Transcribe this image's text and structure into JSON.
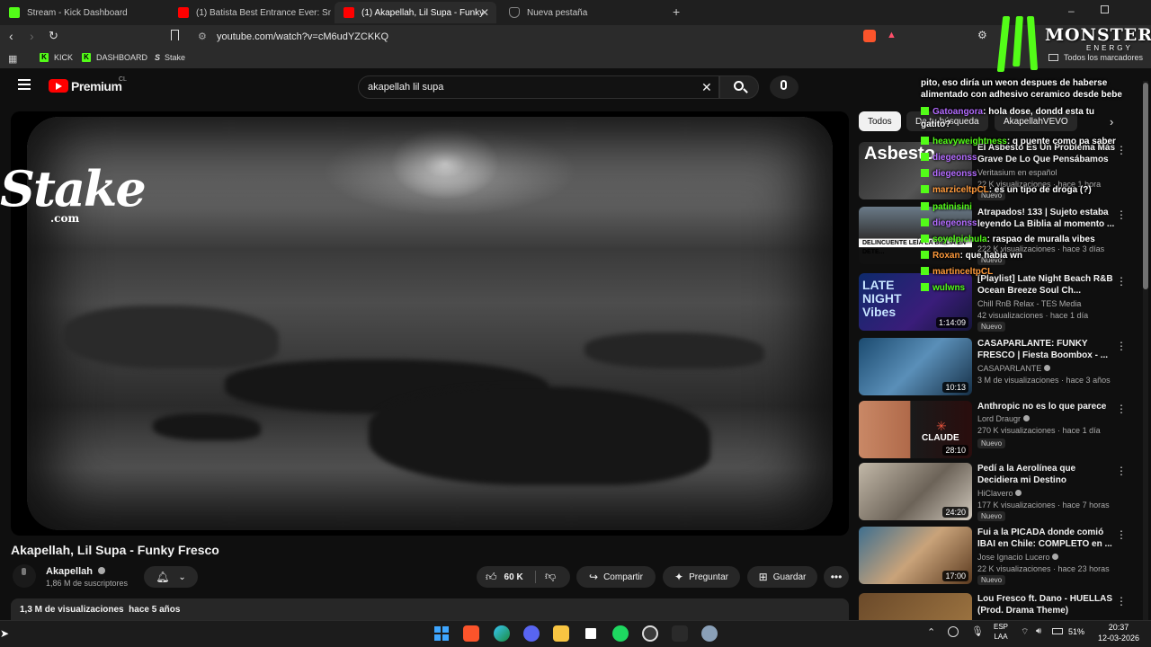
{
  "browser": {
    "tabs": [
      {
        "title": "Stream - Kick Dashboard",
        "favicon_color": "#53fc18"
      },
      {
        "title": "(1) Batista Best Entrance Ever: Smackd",
        "favicon_color": "#ff0000"
      },
      {
        "title": "(1) Akapellah, Lil Supa - Funky",
        "favicon_color": "#ff0000",
        "active": true
      },
      {
        "title": "Nueva pestaña",
        "favicon_color": "#888888"
      }
    ],
    "url": "youtube.com/watch?v=cM6udYZCKKQ",
    "bookmarks": [
      "KICK",
      "DASHBOARD",
      "Stake"
    ],
    "all_bookmarks": "Todos los marcadores"
  },
  "youtube": {
    "logo": "Premium",
    "logo_country": "CL",
    "search_value": "akapellah lil supa",
    "video": {
      "title": "Akapellah, Lil Supa - Funky Fresco",
      "channel": "Akapellah",
      "subscribers": "1,86 M de suscriptores",
      "likes": "60 K",
      "share": "Compartir",
      "ask": "Preguntar",
      "save": "Guardar",
      "views_date": "1,3 M de visualizaciones  hace 5 años"
    },
    "chips": [
      "Todos",
      "De tu búsqueda",
      "AkapellahVEVO"
    ],
    "recommendations": [
      {
        "title": "El Asbesto Es Un Problema Más Grave De Lo Que Pensábamos",
        "channel": "Veritasium en español",
        "meta": "22 K visualizaciones · hace 1 hora",
        "badge": "Nuevo",
        "duration": "",
        "thumb_text": "Asbesto"
      },
      {
        "title": "Atrapados! 133 | Sujeto estaba leyendo La Biblia al momento ...",
        "channel": "",
        "meta": "222 K visualizaciones · hace 3 días",
        "badge": "Nuevo",
        "duration": "",
        "thumb_text": "DELINCUENTE LEÍA LA BIBLIA EN DETE..."
      },
      {
        "title": "[Playlist] Late Night Beach R&B Ocean Breeze Soul Ch...",
        "channel": "Chill RnB Relax - TES Media",
        "meta": "42 visualizaciones · hace 1 día",
        "badge": "Nuevo",
        "duration": "1:14:09",
        "thumb_text": "LATE NIGHT Vibes"
      },
      {
        "title": "CASAPARLANTE: FUNKY FRESCO | Fiesta Boombox - ...",
        "channel": "CASAPARLANTE",
        "meta": "3 M de visualizaciones · hace 3 años",
        "badge": "",
        "duration": "10:13",
        "thumb_text": ""
      },
      {
        "title": "Anthropic no es lo que parece",
        "channel": "Lord Draugr",
        "meta": "270 K visualizaciones · hace 1 día",
        "badge": "Nuevo",
        "duration": "28:10",
        "thumb_text": "CLAUDE"
      },
      {
        "title": "Pedí a la Aerolínea que Decidiera mi Destino",
        "channel": "HiClavero",
        "meta": "177 K visualizaciones · hace 7 horas",
        "badge": "Nuevo",
        "duration": "24:20",
        "thumb_text": ""
      },
      {
        "title": "Fui a la PICADA donde comió IBAI en Chile: COMPLETO en ...",
        "channel": "Jose Ignacio Lucero",
        "meta": "22 K visualizaciones · hace 23 horas",
        "badge": "Nuevo",
        "duration": "17:00",
        "thumb_text": ""
      },
      {
        "title": "Lou Fresco ft. Dano - HUELLAS (Prod. Drama Theme)",
        "channel": "",
        "meta": "",
        "badge": "",
        "duration": "",
        "thumb_text": ""
      }
    ]
  },
  "overlay": {
    "stake_text": "Stake",
    "stake_sub": ".com",
    "monster_text": "MONSTER",
    "monster_sub": "ENERGY",
    "chat": [
      {
        "user": "",
        "text": "pito, eso diría un weon despues de haberse",
        "color": "#ffffff"
      },
      {
        "user": "",
        "text": "alimentado con adhesivo ceramico desde bebe",
        "color": "#ffffff"
      },
      {
        "user": "Gatoangora",
        "text": ": hola dose, dondd esta tu",
        "color": "#b36bff"
      },
      {
        "user": "",
        "text": "gatito?",
        "color": "#ffffff"
      },
      {
        "user": "heavyweightness",
        "text": ": q puente como pa saber",
        "color": "#53fc18"
      },
      {
        "user": "diegeonss",
        "text": "",
        "color": "#b36bff"
      },
      {
        "user": "diegeonss",
        "text": "",
        "color": "#b36bff"
      },
      {
        "user": "marziceltpCL",
        "text": ": es un tipo de droga (?)",
        "color": "#ff9a3c"
      },
      {
        "user": "patinisini",
        "text": "",
        "color": "#53fc18"
      },
      {
        "user": "diegeonss",
        "text": "",
        "color": "#b36bff"
      },
      {
        "user": "soyelpichula",
        "text": ": raspao de muralla vibes",
        "color": "#53fc18"
      },
      {
        "user": "Roxan",
        "text": ": que habia wn",
        "color": "#ff9a3c"
      },
      {
        "user": "martinceltpCL",
        "text": "",
        "color": "#ff9a3c"
      },
      {
        "user": "wulwns",
        "text": "",
        "color": "#53fc18"
      }
    ]
  },
  "taskbar": {
    "lang": "ESP",
    "lang2": "LAA",
    "battery": "51%",
    "time": "20:37",
    "date": "12-03-2026"
  }
}
